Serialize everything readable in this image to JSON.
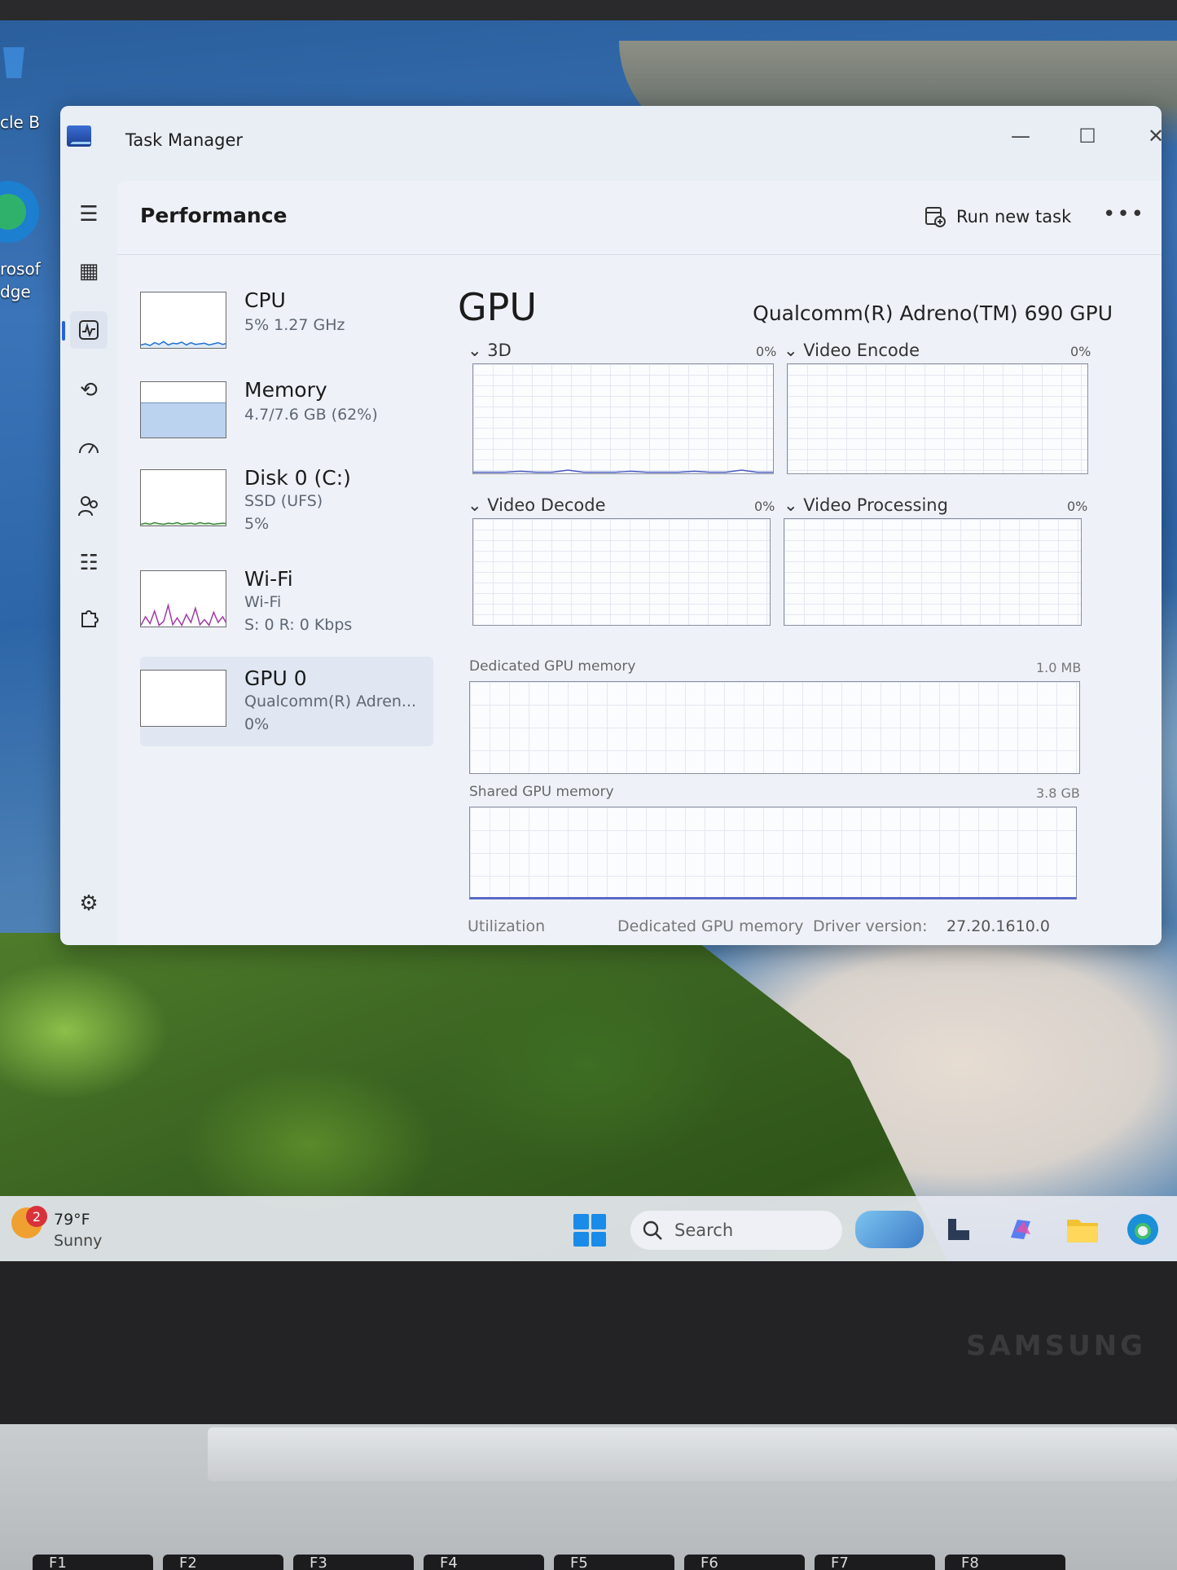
{
  "desktop": {
    "icons": [
      {
        "label": "cle B",
        "name": "recycle-bin"
      },
      {
        "label": "rosof",
        "name": "edge-shortcut"
      },
      {
        "label": "dge",
        "name": "edge-shortcut-2"
      }
    ]
  },
  "window": {
    "title": "Task Manager",
    "controls": {
      "minimize": "—",
      "maximize": "☐",
      "close": "✕"
    }
  },
  "nav": {
    "items": [
      {
        "name": "hamburger-menu-icon",
        "glyph": "☰"
      },
      {
        "name": "processes-icon",
        "glyph": "▦"
      },
      {
        "name": "performance-icon",
        "glyph": "📈",
        "active": true
      },
      {
        "name": "app-history-icon",
        "glyph": "⟲"
      },
      {
        "name": "startup-apps-icon",
        "glyph": "⚡"
      },
      {
        "name": "users-icon",
        "glyph": "👥"
      },
      {
        "name": "details-icon",
        "glyph": "☷"
      },
      {
        "name": "services-icon",
        "glyph": "⚙"
      }
    ],
    "settings_glyph": "⚙"
  },
  "header": {
    "title": "Performance",
    "run_new_task": "Run new task",
    "more": "•••"
  },
  "devices": [
    {
      "name": "CPU",
      "sub1": "5%  1.27 GHz",
      "sub2": "",
      "series": [
        92,
        90,
        93,
        88,
        91,
        86,
        92,
        89,
        90,
        87,
        92,
        88,
        91,
        90,
        89,
        92,
        90,
        88,
        91,
        89
      ]
    },
    {
      "name": "Memory",
      "sub1": "4.7/7.6 GB (62%)",
      "sub2": "",
      "fill": 0.62
    },
    {
      "name": "Disk 0 (C:)",
      "sub1": "SSD (UFS)",
      "sub2": "5%",
      "series": [
        95,
        93,
        95,
        92,
        94,
        95,
        93,
        94,
        92,
        95,
        94,
        93,
        95,
        92,
        94,
        93,
        95,
        94,
        93,
        94
      ]
    },
    {
      "name": "Wi-Fi",
      "sub1": "Wi-Fi",
      "sub2": "S: 0  R: 0 Kbps",
      "series": [
        95,
        80,
        92,
        70,
        95,
        88,
        60,
        94,
        82,
        95,
        76,
        90,
        65,
        94,
        85,
        95,
        72,
        90,
        80,
        94
      ]
    },
    {
      "name": "GPU 0",
      "sub1": "Qualcomm(R) Adren...",
      "sub2": "0%",
      "selected": true
    }
  ],
  "gpu": {
    "title": "GPU",
    "model": "Qualcomm(R) Adreno(TM) 690 GPU",
    "engines": [
      {
        "label": "3D",
        "pct": "0%",
        "series": [
          99,
          99,
          99,
          98,
          99,
          99,
          97,
          99,
          99,
          99,
          98,
          99,
          99,
          99,
          98,
          99,
          99,
          97,
          99,
          99
        ]
      },
      {
        "label": "Video Encode",
        "pct": "0%"
      },
      {
        "label": "Video Decode",
        "pct": "0%"
      },
      {
        "label": "Video Processing",
        "pct": "0%"
      }
    ],
    "dedicated": {
      "label": "Dedicated GPU memory",
      "value": "1.0 MB"
    },
    "shared": {
      "label": "Shared GPU memory",
      "value": "3.8 GB"
    },
    "footer": {
      "utilization": "Utilization",
      "dedicated": "Dedicated GPU memory",
      "driver_label": "Driver version:",
      "driver_value": "27.20.1610.0"
    }
  },
  "taskbar": {
    "weather_count": "2",
    "temp": "79°F",
    "condition": "Sunny",
    "search_placeholder": "Search"
  },
  "laptop": {
    "brand": "SAMSUNG",
    "keys": [
      "F1",
      "F2",
      "F3",
      "F4",
      "F5",
      "F6",
      "F7",
      "F8"
    ]
  },
  "colors": {
    "accent": "#2a62d6",
    "cpu_line": "#1f6fd1",
    "wifi_line": "#a03aa8",
    "disk_line": "#3a8a3a",
    "memory_fill": "#bcd3ef",
    "gpu_line": "#4a5bbf"
  }
}
